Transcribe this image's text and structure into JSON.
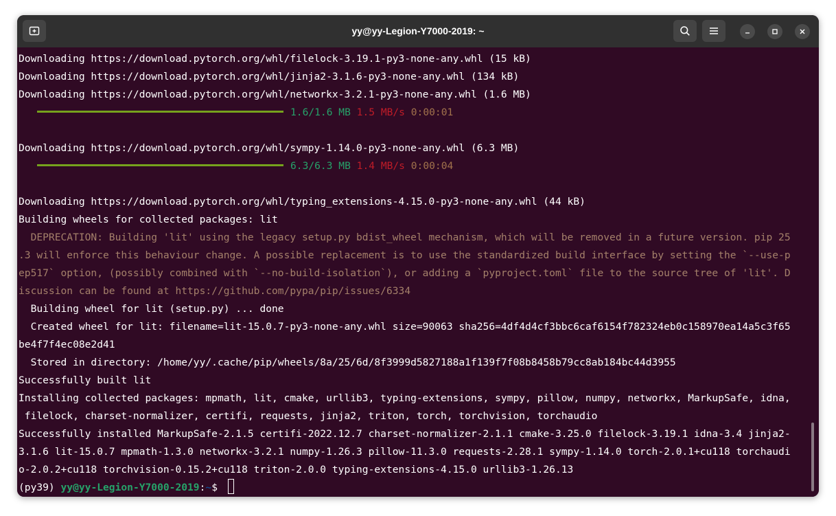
{
  "window": {
    "title": "yy@yy-Legion-Y7000-2019: ~",
    "icons": {
      "new_tab": "new-tab-icon",
      "search": "search-icon",
      "menu": "hamburger-menu-icon",
      "minimize": "minimize-icon",
      "maximize": "maximize-icon",
      "close": "close-icon"
    }
  },
  "colors": {
    "terminal_bg": "#300a24",
    "progress_bar": "#76a21d",
    "progress_size": "#26a269",
    "progress_rate": "#c01c28",
    "progress_eta": "#a2734c",
    "deprecation_text": "#a4806a",
    "prompt_user": "#26a269",
    "prompt_path": "#12488b"
  },
  "terminal": {
    "lines": [
      "Downloading https://download.pytorch.org/whl/filelock-3.19.1-py3-none-any.whl (15 kB)",
      "Downloading https://download.pytorch.org/whl/jinja2-3.1.6-py3-none-any.whl (134 kB)",
      "Downloading https://download.pytorch.org/whl/networkx-3.2.1-py3-none-any.whl (1.6 MB)",
      "Downloading https://download.pytorch.org/whl/sympy-1.14.0-py3-none-any.whl (6.3 MB)",
      "Downloading https://download.pytorch.org/whl/typing_extensions-4.15.0-py3-none-any.whl (44 kB)",
      "Building wheels for collected packages: lit",
      "  DEPRECATION: Building 'lit' using the legacy setup.py bdist_wheel mechanism, which will be removed in a future version. pip 25",
      ".3 will enforce this behaviour change. A possible replacement is to use the standardized build interface by setting the `--use-p",
      "ep517` option, (possibly combined with `--no-build-isolation`), or adding a `pyproject.toml` file to the source tree of 'lit'. D",
      "iscussion can be found at https://github.com/pypa/pip/issues/6334",
      "  Building wheel for lit (setup.py) ... done",
      "  Created wheel for lit: filename=lit-15.0.7-py3-none-any.whl size=90063 sha256=4df4d4cf3bbc6caf6154f782324eb0c158970ea14a5c3f65",
      "be4f7f4ec08e2d41",
      "  Stored in directory: /home/yy/.cache/pip/wheels/8a/25/6d/8f3999d5827188a1f139f7f08b8458b79cc8ab184bc44d3955",
      "Successfully built lit",
      "Installing collected packages: mpmath, lit, cmake, urllib3, typing-extensions, sympy, pillow, numpy, networkx, MarkupSafe, idna,",
      " filelock, charset-normalizer, certifi, requests, jinja2, triton, torch, torchvision, torchaudio",
      "Successfully installed MarkupSafe-2.1.5 certifi-2022.12.7 charset-normalizer-2.1.1 cmake-3.25.0 filelock-3.19.1 idna-3.4 jinja2-",
      "3.1.6 lit-15.0.7 mpmath-1.3.0 networkx-3.2.1 numpy-1.26.3 pillow-11.3.0 requests-2.28.1 sympy-1.14.0 torch-2.0.1+cu118 torchaudi",
      "o-2.0.2+cu118 torchvision-0.15.2+cu118 triton-2.0.0 typing-extensions-4.15.0 urllib3-1.26.13"
    ],
    "progress": [
      {
        "size": "1.6/1.6 MB",
        "rate": "1.5 MB/s",
        "eta": "0:00:01",
        "fraction": 1.0
      },
      {
        "size": "6.3/6.3 MB",
        "rate": "1.4 MB/s",
        "eta": "0:00:04",
        "fraction": 1.0
      }
    ],
    "prompt": {
      "env": "(py39) ",
      "user_host": "yy@yy-Legion-Y7000-2019",
      "colon": ":",
      "path": "~",
      "symbol": "$ "
    }
  }
}
